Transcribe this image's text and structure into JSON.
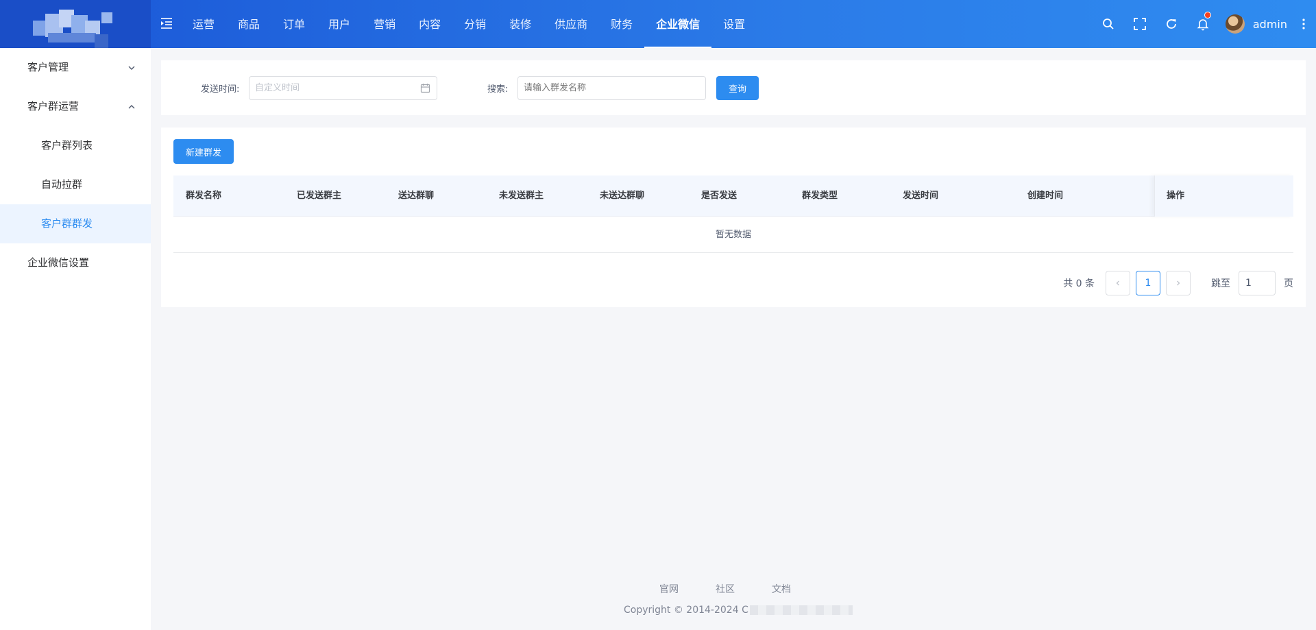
{
  "header": {
    "nav": [
      "运营",
      "商品",
      "订单",
      "用户",
      "营销",
      "内容",
      "分销",
      "装修",
      "供应商",
      "财务",
      "企业微信",
      "设置"
    ],
    "active_nav": "企业微信",
    "username": "admin"
  },
  "sidebar": {
    "items": [
      {
        "label": "客户管理",
        "level": "parent",
        "expanded": false
      },
      {
        "label": "客户群运营",
        "level": "parent",
        "expanded": true
      },
      {
        "label": "客户群列表",
        "level": "child"
      },
      {
        "label": "自动拉群",
        "level": "child"
      },
      {
        "label": "客户群群发",
        "level": "child",
        "active": true
      },
      {
        "label": "企业微信设置",
        "level": "parent"
      }
    ]
  },
  "filter": {
    "time_label": "发送时间:",
    "time_placeholder": "自定义时间",
    "search_label": "搜索:",
    "search_placeholder": "请输入群发名称",
    "query_button": "查询"
  },
  "table": {
    "new_button": "新建群发",
    "columns": [
      "群发名称",
      "已发送群主",
      "送达群聊",
      "未发送群主",
      "未送达群聊",
      "是否发送",
      "群发类型",
      "发送时间",
      "创建时间"
    ],
    "ops_column": "操作",
    "empty_text": "暂无数据"
  },
  "pagination": {
    "total_text": "共 0 条",
    "current_page": "1",
    "jump_label": "跳至",
    "jump_value": "1",
    "page_suffix": "页"
  },
  "footer": {
    "links": [
      "官网",
      "社区",
      "文档"
    ],
    "copyright": "Copyright © 2014-2024 C"
  },
  "colors": {
    "primary": "#2d8cf0",
    "header_start": "#1a56d6",
    "header_end": "#2f8cf0",
    "notification_dot": "#f5401f"
  }
}
